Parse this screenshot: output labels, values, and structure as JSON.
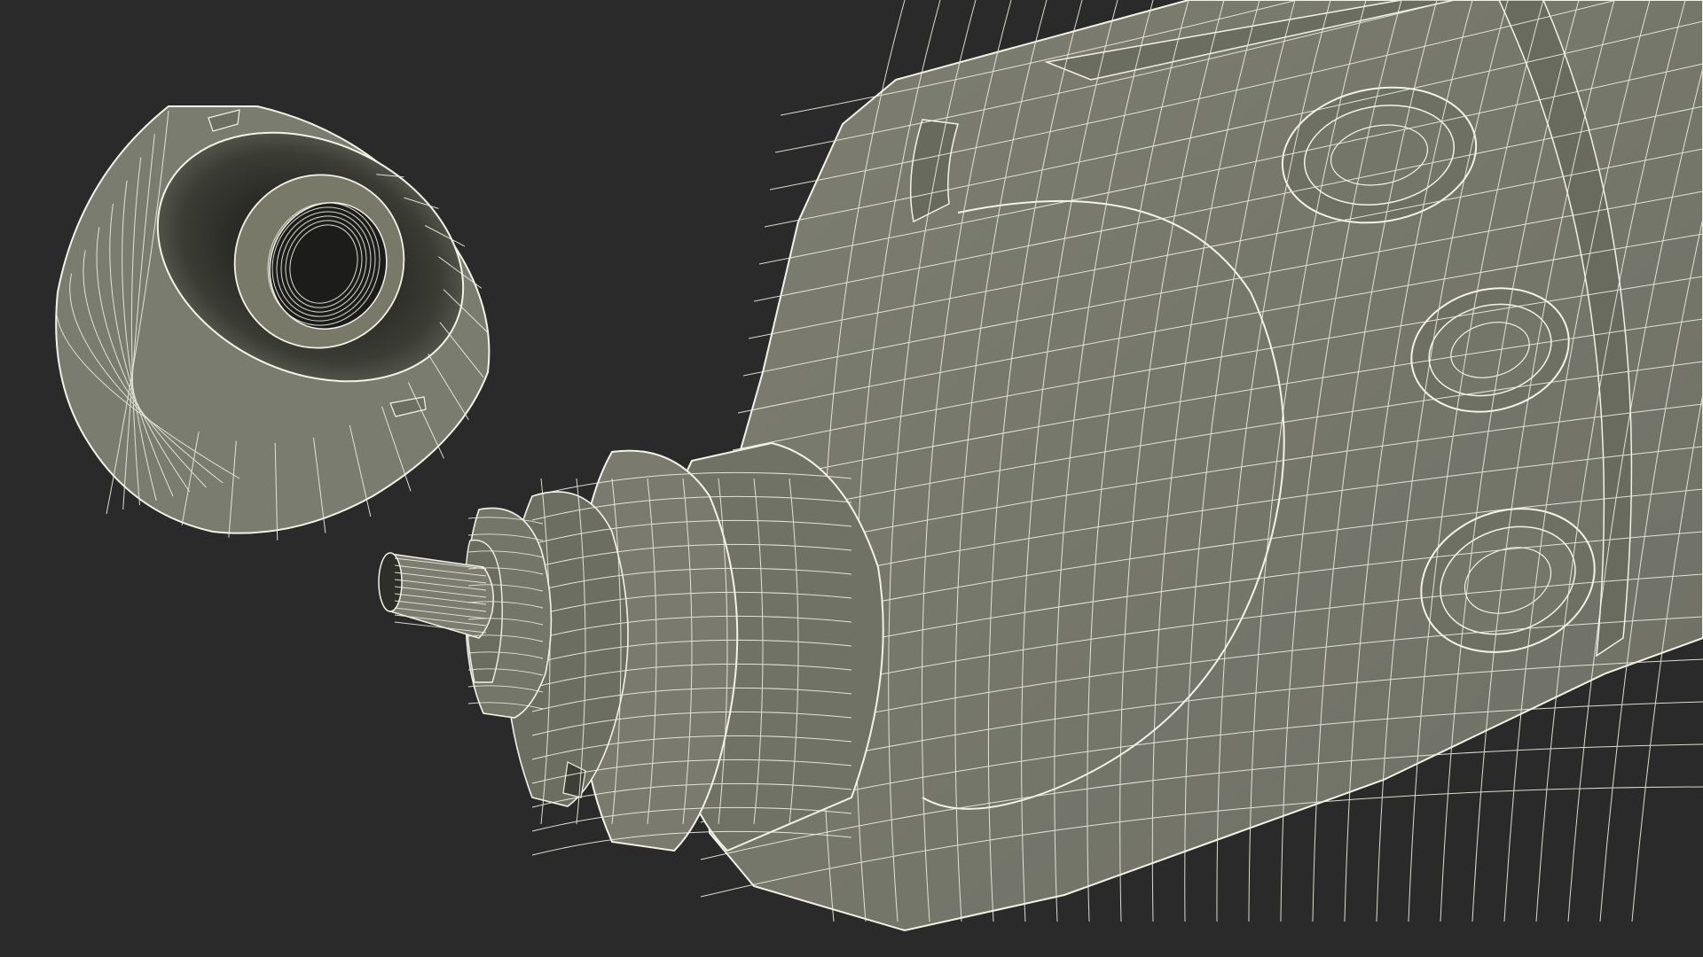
{
  "scene": {
    "background_color": "#2a2a2a",
    "mesh_fill_color": "#78796c",
    "mesh_fill_dark": "#55574c",
    "mesh_interior_color": "#3a3b33",
    "wire_color": "#eef0e2",
    "objects": [
      "bottle-cap",
      "bottle-body",
      "bottle-nozzle"
    ]
  }
}
